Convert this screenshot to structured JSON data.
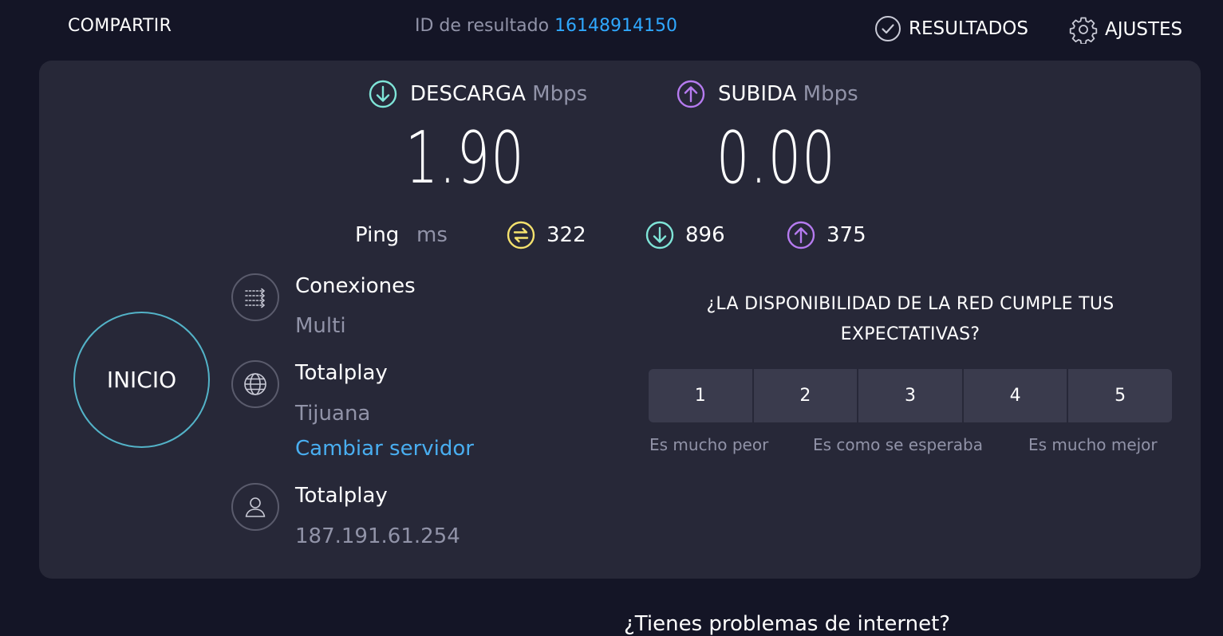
{
  "topbar": {
    "share_label": "COMPARTIR",
    "result_id_label": "ID de resultado",
    "result_id_value": "16148914150",
    "results_label": "RESULTADOS",
    "settings_label": "AJUSTES"
  },
  "download": {
    "label": "DESCARGA",
    "unit": "Mbps",
    "value": "1.90",
    "icon": "download-arrow-icon",
    "color": "#7fe5d8"
  },
  "upload": {
    "label": "SUBIDA",
    "unit": "Mbps",
    "value": "0.00",
    "icon": "upload-arrow-icon",
    "color": "#b67bf0"
  },
  "ping": {
    "label": "Ping",
    "unit": "ms",
    "idle": "322",
    "download": "896",
    "upload": "375",
    "idle_color": "#f5e26e"
  },
  "go_button": {
    "label": "INICIO"
  },
  "connections": {
    "title": "Conexiones",
    "value": "Multi",
    "icon": "connections-icon"
  },
  "server": {
    "name": "Totalplay",
    "location": "Tijuana",
    "change_label": "Cambiar servidor",
    "icon": "globe-icon"
  },
  "provider": {
    "name": "Totalplay",
    "ip": "187.191.61.254",
    "icon": "user-icon"
  },
  "survey": {
    "question": "¿LA DISPONIBILIDAD DE LA RED CUMPLE TUS EXPECTATIVAS?",
    "options": [
      "1",
      "2",
      "3",
      "4",
      "5"
    ],
    "low_label": "Es mucho peor",
    "mid_label": "Es como se esperaba",
    "high_label": "Es mucho mejor"
  },
  "footer": {
    "question": "¿Tienes problemas de internet?"
  },
  "colors": {
    "background": "#141526",
    "panel": "#272838",
    "accent_link": "#49aef0",
    "go_ring": "#53b3c8"
  }
}
